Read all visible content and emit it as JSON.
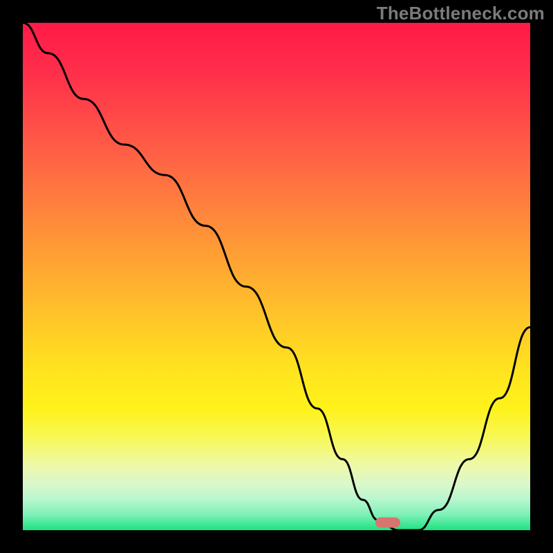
{
  "site": {
    "watermark": "TheBottleneck.com"
  },
  "colors": {
    "frame": "#000000",
    "watermark": "#7b7b7b",
    "curve": "#000000",
    "marker": "#d8746e",
    "gradient_stops": [
      "#ff1a48",
      "#ff2f4a",
      "#ff5447",
      "#ff7a3f",
      "#ffa034",
      "#ffc529",
      "#ffe21f",
      "#fff21a",
      "#f7f85a",
      "#eef9a6",
      "#d9f8cc",
      "#b7f6ce",
      "#7df0b6",
      "#1ce281"
    ]
  },
  "chart_data": {
    "type": "line",
    "title": "",
    "xlabel": "",
    "ylabel": "",
    "xlim": [
      0,
      100
    ],
    "ylim": [
      0,
      100
    ],
    "grid": false,
    "legend": false,
    "series": [
      {
        "name": "bottleneck-curve",
        "x": [
          0,
          5,
          12,
          20,
          28,
          36,
          44,
          52,
          58,
          63,
          67,
          70,
          74,
          78,
          82,
          88,
          94,
          100
        ],
        "y": [
          100,
          94,
          85,
          76,
          70,
          60,
          48,
          36,
          24,
          14,
          6,
          2,
          0,
          0,
          4,
          14,
          26,
          40
        ]
      }
    ],
    "marker": {
      "x": 72,
      "y": 1.5
    },
    "notes": "y is the curve height as a percentage of the plot area; higher y = higher on screen. Values estimated from pixels."
  }
}
